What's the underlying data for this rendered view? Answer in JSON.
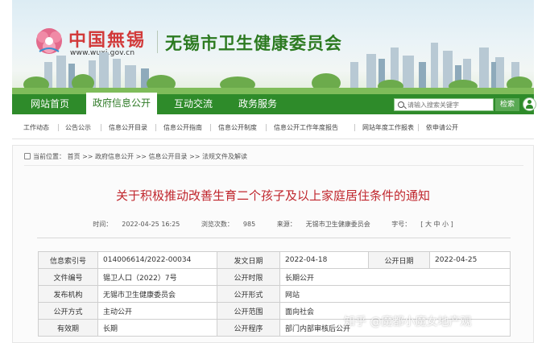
{
  "header": {
    "logo_cn": "中国無锡",
    "logo_url": "www.wuxi.gov.cn",
    "site_title": "无锡市卫生健康委员会"
  },
  "nav": {
    "items": [
      "网站首页",
      "政府信息公开",
      "互动交流",
      "政务服务"
    ],
    "active_index": 1,
    "search_placeholder": "请输入搜索关键字",
    "search_button": "检索"
  },
  "subnav": {
    "items": [
      "工作动态",
      "公告公示",
      "信息公开目录",
      "信息公开指南",
      "信息公开制度",
      "信息公开工作年度报告",
      "网站年度工作报表",
      "依申请公开"
    ]
  },
  "breadcrumb": {
    "prefix": "当前位置：",
    "items": [
      "首页",
      "政府信息公开",
      "信息公开目录",
      "法规文件及解读"
    ],
    "separator": ">>"
  },
  "article": {
    "title": "关于积极推动改善生育二个孩子及以上家庭居住条件的通知",
    "time_label": "时间：",
    "time": "2022-04-25 16:25",
    "views_label": "浏览次数：",
    "views": "985",
    "source_label": "来源：",
    "source": "无锡市卫生健康委员会",
    "fontsize_label": "字号：",
    "fontsize_options": "[ 大 中 小 ]"
  },
  "info_table": {
    "rows": [
      [
        {
          "k": "信息索引号",
          "v": "014006614/2022-00034"
        },
        {
          "k": "发文日期",
          "v": "2022-04-18"
        },
        {
          "k": "公开日期",
          "v": "2022-04-25"
        }
      ],
      [
        {
          "k": "文件编号",
          "v": "锡卫人口（2022）7号"
        },
        {
          "k": "公开时限",
          "v": "长期公开"
        }
      ],
      [
        {
          "k": "发布机构",
          "v": "无锡市卫生健康委员会"
        },
        {
          "k": "公开形式",
          "v": "网站"
        }
      ],
      [
        {
          "k": "公开方式",
          "v": "主动公开"
        },
        {
          "k": "公开范围",
          "v": "面向社会"
        }
      ],
      [
        {
          "k": "有效期",
          "v": "长期"
        },
        {
          "k": "公开程序",
          "v": "部门内部审核后公开"
        }
      ]
    ]
  },
  "watermark": "知乎 @魔都小魔女地产观",
  "colors": {
    "nav_green": "#2e8b2a",
    "title_green": "#2c7a20",
    "title_red": "#c0262d"
  }
}
